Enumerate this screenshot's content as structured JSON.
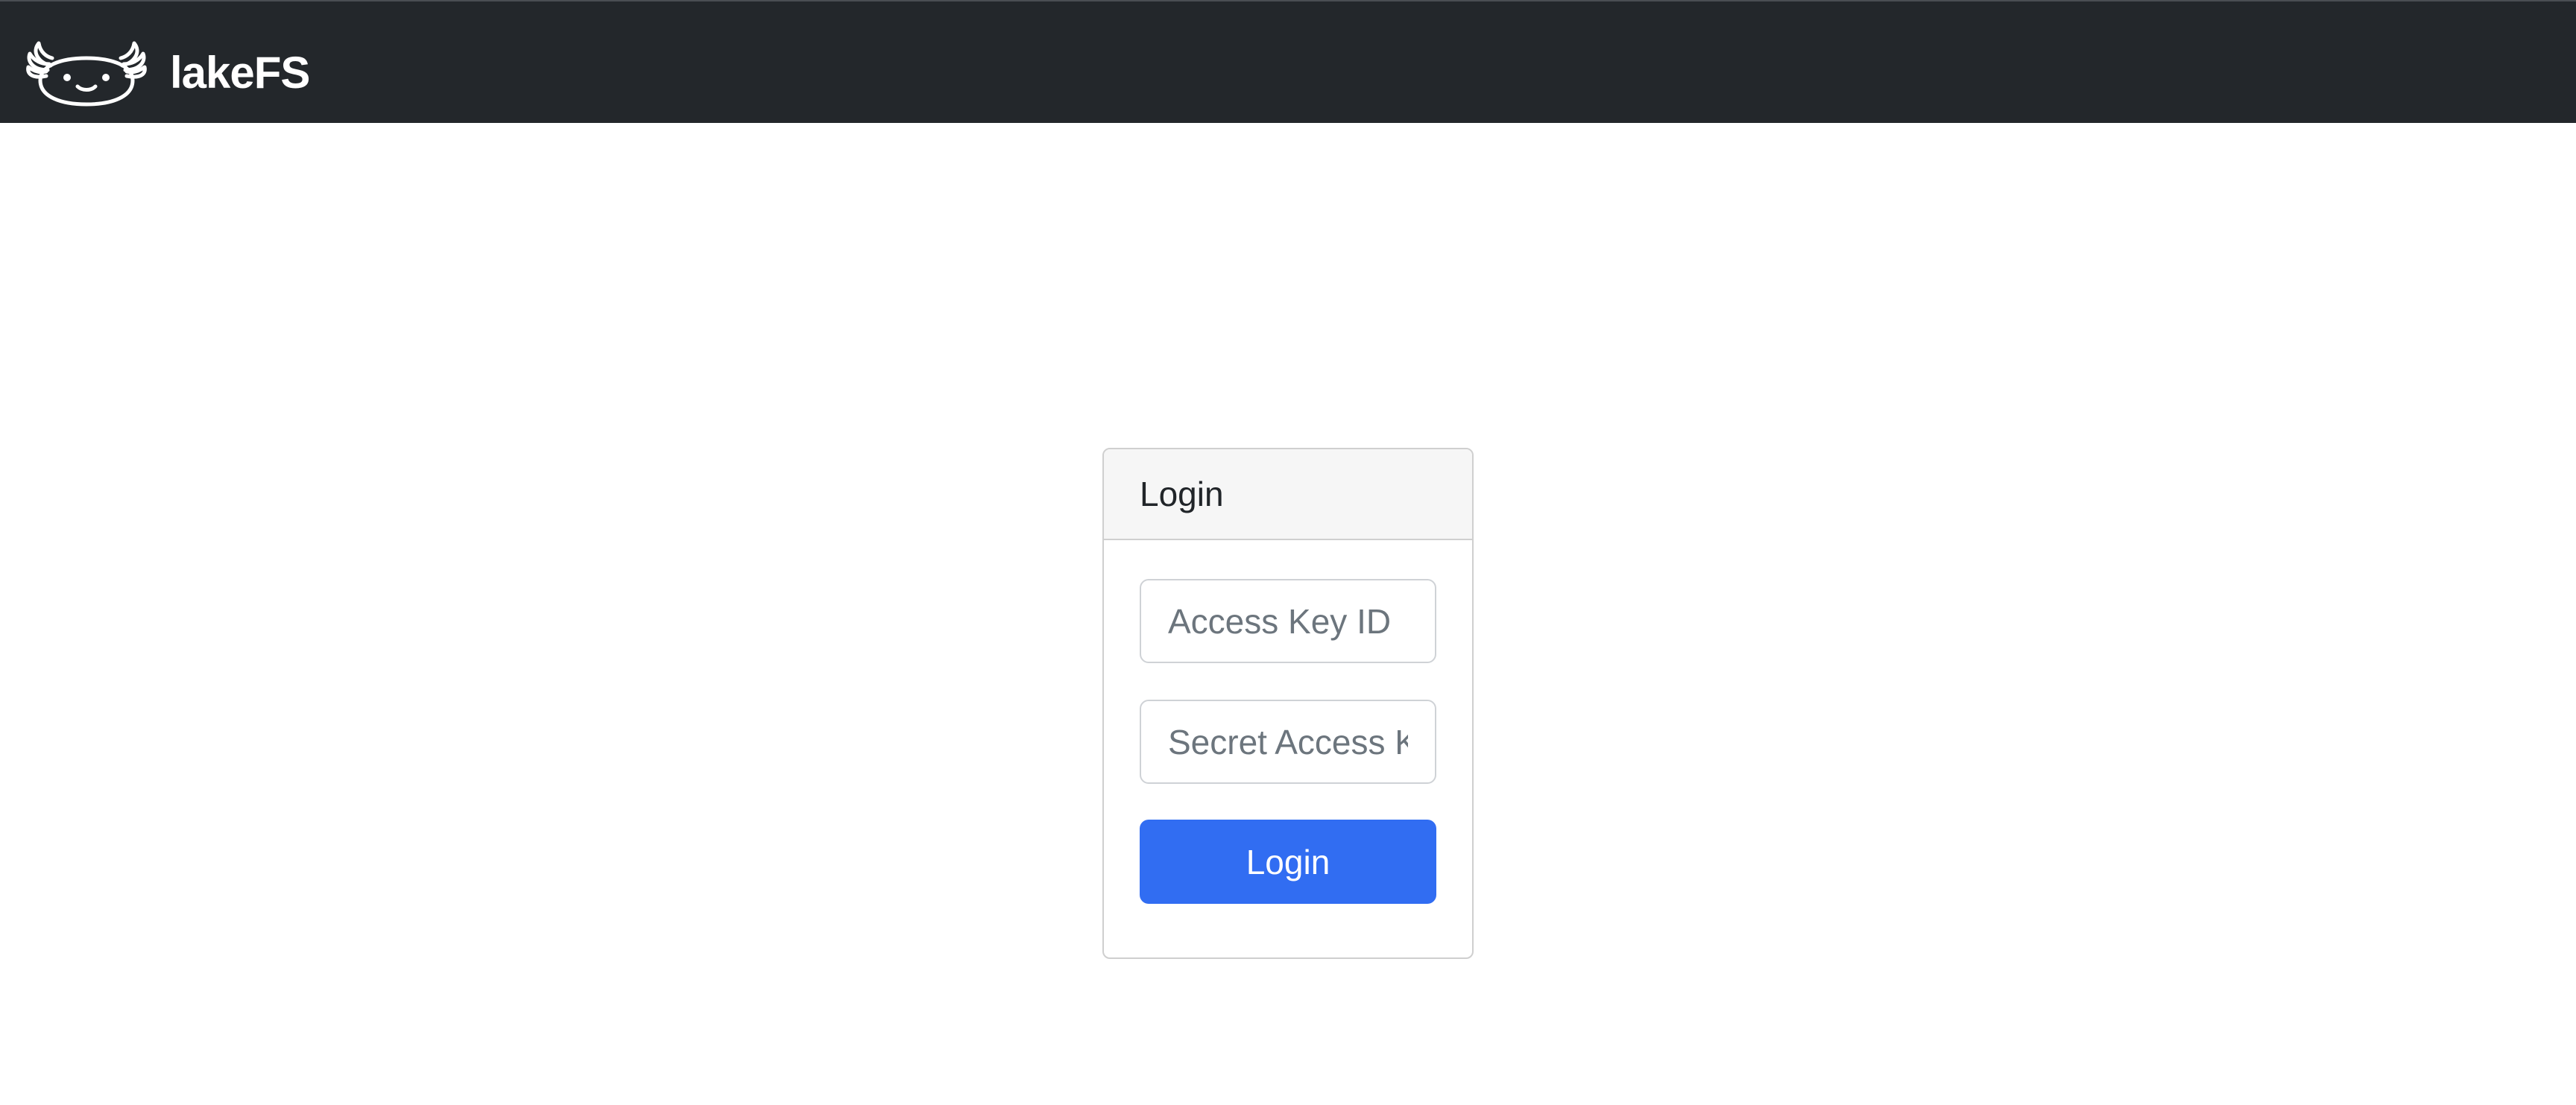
{
  "navbar": {
    "brand_text": "lakeFS",
    "logo_icon": "lakefs-axolotl-logo-icon",
    "background_color": "#23272b"
  },
  "login_card": {
    "header_title": "Login",
    "access_key": {
      "placeholder": "Access Key ID",
      "value": ""
    },
    "secret_key": {
      "placeholder": "Secret Access Key",
      "value": ""
    },
    "submit_label": "Login",
    "submit_color": "#316df2"
  }
}
